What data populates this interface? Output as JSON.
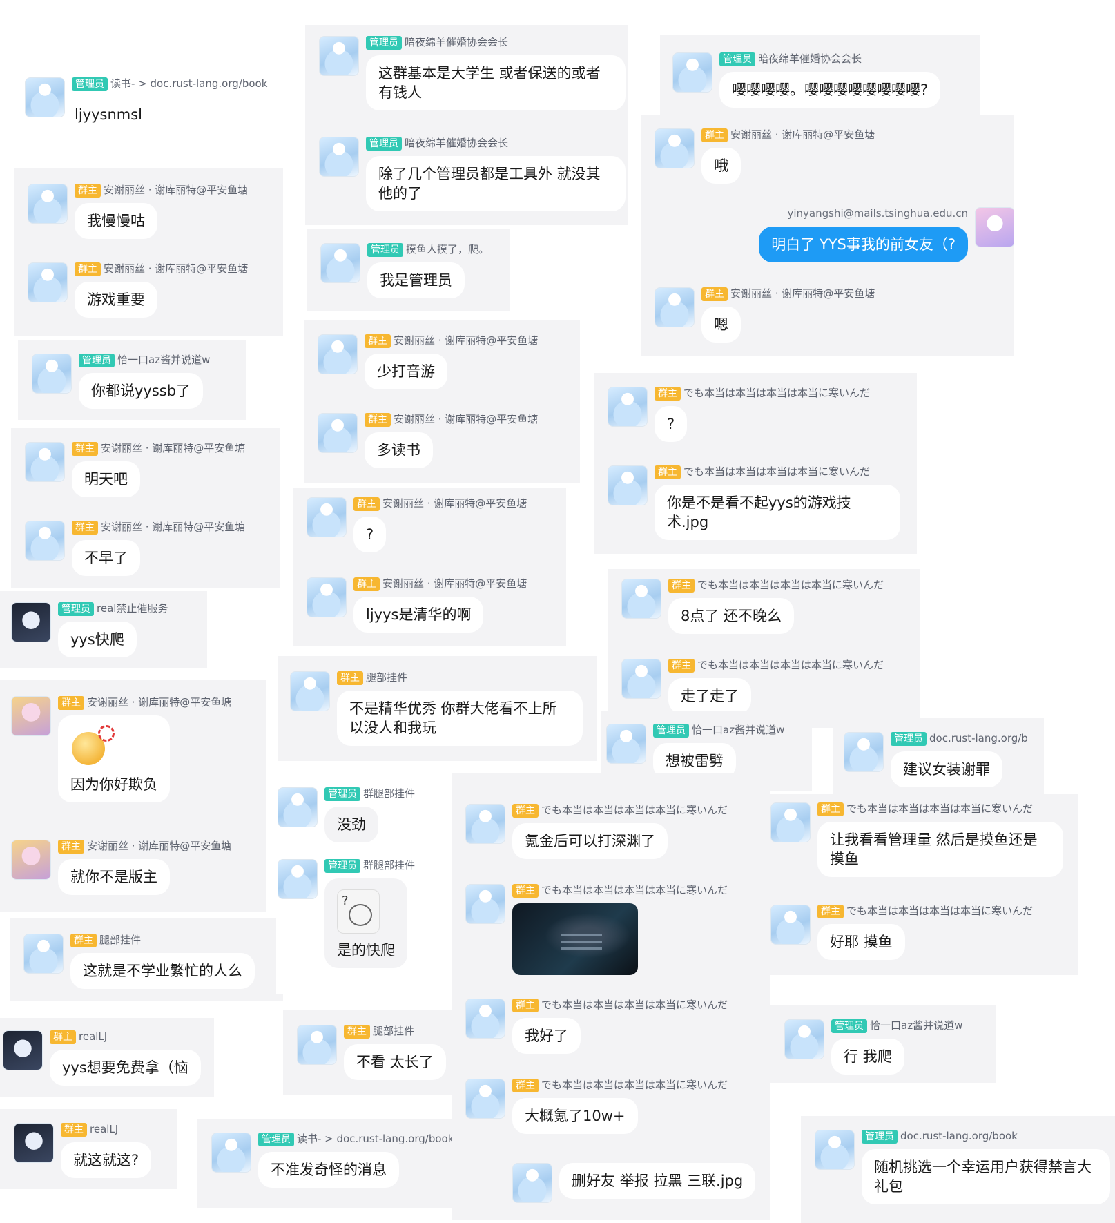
{
  "messages": [
    {
      "role": "管理员",
      "name": "读书- > doc.rust-lang.org/book",
      "text": "ljyysnmsl"
    },
    {
      "role": "群主",
      "name": "安谢丽丝 · 谢库丽特@平安鱼塘",
      "text": "我慢慢咕"
    },
    {
      "role": "群主",
      "name": "安谢丽丝 · 谢库丽特@平安鱼塘",
      "text": "游戏重要"
    },
    {
      "role": "管理员",
      "name": "恰一口az酱并说道w",
      "text": "你都说yyssb了"
    },
    {
      "role": "群主",
      "name": "安谢丽丝 · 谢库丽特@平安鱼塘",
      "text": "明天吧"
    },
    {
      "role": "群主",
      "name": "安谢丽丝 · 谢库丽特@平安鱼塘",
      "text": "不早了"
    },
    {
      "role": "管理员",
      "name": "real禁止催服务",
      "text": "yys快爬"
    },
    {
      "role": "群主",
      "name": "安谢丽丝 · 谢库丽特@平安鱼塘",
      "text": "因为你好欺负"
    },
    {
      "role": "群主",
      "name": "安谢丽丝 · 谢库丽特@平安鱼塘",
      "text": "就你不是版主"
    },
    {
      "role": "群主",
      "name": "腿部挂件",
      "text": "这就是不学业繁忙的人么"
    },
    {
      "role": "群主",
      "name": "realLJ",
      "text": "yys想要免费拿（恼"
    },
    {
      "role": "群主",
      "name": "realLJ",
      "text": "就这就这?"
    },
    {
      "role": "管理员",
      "name": "暗夜绵羊催婚协会会长",
      "text": "这群基本是大学生 或者保送的或者有钱人"
    },
    {
      "role": "管理员",
      "name": "暗夜绵羊催婚协会会长",
      "text": "除了几个管理员都是工具外 就没其他的了"
    },
    {
      "role": "管理员",
      "name": "摸鱼人摸了，爬。",
      "text": "我是管理员"
    },
    {
      "role": "群主",
      "name": "安谢丽丝 · 谢库丽特@平安鱼塘",
      "text": "少打音游"
    },
    {
      "role": "群主",
      "name": "安谢丽丝 · 谢库丽特@平安鱼塘",
      "text": "多读书"
    },
    {
      "role": "群主",
      "name": "安谢丽丝 · 谢库丽特@平安鱼塘",
      "text": "?"
    },
    {
      "role": "群主",
      "name": "安谢丽丝 · 谢库丽特@平安鱼塘",
      "text": "ljyys是清华的啊"
    },
    {
      "role": "群主",
      "name": "腿部挂件",
      "text": "不是精华优秀 你群大佬看不上所以没人和我玩"
    },
    {
      "role": "管理员",
      "name": "群腿部挂件",
      "text": "没劲"
    },
    {
      "role": "管理员",
      "name": "群腿部挂件",
      "text": "是的快爬"
    },
    {
      "role": "群主",
      "name": "腿部挂件",
      "text": "不看 太长了"
    },
    {
      "role": "管理员",
      "name": "读书- > doc.rust-lang.org/book",
      "text": "不准发奇怪的消息"
    },
    {
      "role": "管理员",
      "name": "暗夜绵羊催婚协会会长",
      "text": "嘤嘤嘤嘤。嘤嘤嘤嘤嘤嘤嘤嘤?"
    },
    {
      "role": "群主",
      "name": "安谢丽丝 · 谢库丽特@平安鱼塘",
      "text": "哦"
    },
    {
      "role": "",
      "name": "yinyangshi@mails.tsinghua.edu.cn",
      "text": "明白了 YYS事我的前女友（?"
    },
    {
      "role": "群主",
      "name": "安谢丽丝 · 谢库丽特@平安鱼塘",
      "text": "嗯"
    },
    {
      "role": "群主",
      "name": "でも本当は本当は本当は本当に寒いんだ",
      "text": "?"
    },
    {
      "role": "群主",
      "name": "でも本当は本当は本当は本当に寒いんだ",
      "text": "你是不是看不起yys的游戏技术.jpg"
    },
    {
      "role": "群主",
      "name": "でも本当は本当は本当は本当に寒いんだ",
      "text": "8点了 还不晚么"
    },
    {
      "role": "群主",
      "name": "でも本当は本当は本当は本当に寒いんだ",
      "text": "走了走了"
    },
    {
      "role": "管理员",
      "name": "恰一口az酱并说道w",
      "text": "想被雷劈"
    },
    {
      "role": "管理员",
      "name": "doc.rust-lang.org/b",
      "text": "建议女装谢罪"
    },
    {
      "role": "群主",
      "name": "でも本当は本当は本当は本当に寒いんだ",
      "text": "氪金后可以打深渊了"
    },
    {
      "role": "群主",
      "name": "でも本当は本当は本当は本当に寒いんだ",
      "text": ""
    },
    {
      "role": "群主",
      "name": "でも本当は本当は本当は本当に寒いんだ",
      "text": "我好了"
    },
    {
      "role": "群主",
      "name": "でも本当は本当は本当は本当に寒いんだ",
      "text": "大概氪了10w+"
    },
    {
      "role": "",
      "name": "",
      "text": "删好友 举报 拉黑 三联.jpg"
    },
    {
      "role": "群主",
      "name": "でも本当は本当は本当は本当に寒いんだ",
      "text": "让我看看管理量 然后是摸鱼还是摸鱼"
    },
    {
      "role": "群主",
      "name": "でも本当は本当は本当は本当に寒いんだ",
      "text": "好耶 摸鱼"
    },
    {
      "role": "管理员",
      "name": "恰一口az酱并说道w",
      "text": "行 我爬"
    },
    {
      "role": "管理员",
      "name": "doc.rust-lang.org/book",
      "text": "随机挑选一个幸运用户获得禁言大礼包"
    }
  ],
  "colors": {
    "admin_badge": "#31c9b4",
    "owner_badge": "#f7b731",
    "self_bubble": "#1e9bf5"
  },
  "icons": {
    "avatar": "avatar-icon",
    "emoji": "angry-emoji-icon",
    "sticker": "question-face-sticker-icon",
    "photo": "game-screenshot-image"
  }
}
